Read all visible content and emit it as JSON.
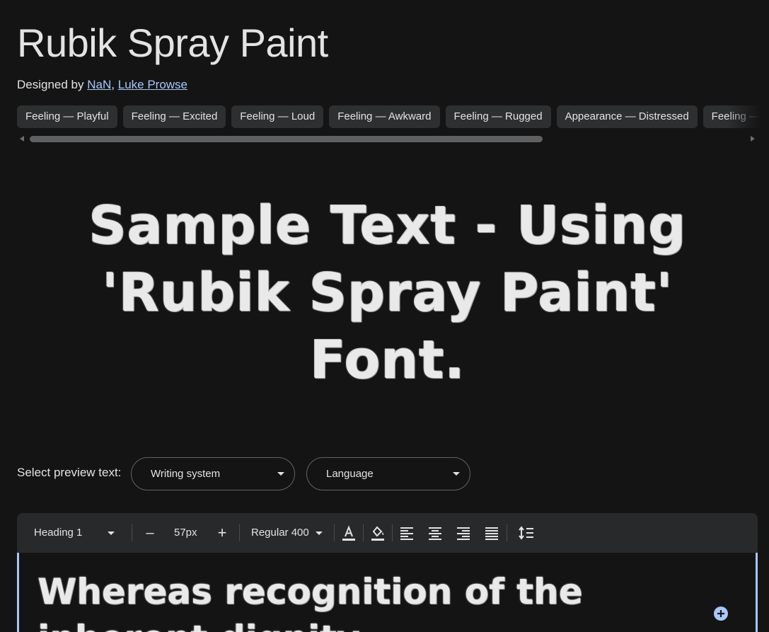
{
  "font": {
    "name": "Rubik Spray Paint",
    "designed_by_label": "Designed by",
    "designer_separator": ",",
    "designers": [
      "NaN",
      "Luke Prowse"
    ]
  },
  "tags": [
    "Feeling — Playful",
    "Feeling — Excited",
    "Feeling — Loud",
    "Feeling — Awkward",
    "Feeling — Rugged",
    "Appearance — Distressed",
    "Feeling — ..."
  ],
  "sample_text": "Sample Text - Using 'Rubik Spray Paint' Font.",
  "preview": {
    "label": "Select preview text:",
    "writing_system": "Writing system",
    "language": "Language"
  },
  "toolbar": {
    "style": "Heading 1",
    "decrease": "–",
    "size": "57px",
    "increase": "+",
    "weight": "Regular 400"
  },
  "editor_text": "Whereas recognition of the inherent dignity",
  "colors": {
    "background": "#141414",
    "link": "#a8c7fa",
    "chip": "#2d2f31",
    "toolbar": "#28292a"
  },
  "icons": [
    "text-color-icon",
    "highlight-color-icon",
    "align-left-icon",
    "align-center-icon",
    "align-right-icon",
    "align-justify-icon",
    "line-height-icon",
    "add-icon"
  ]
}
